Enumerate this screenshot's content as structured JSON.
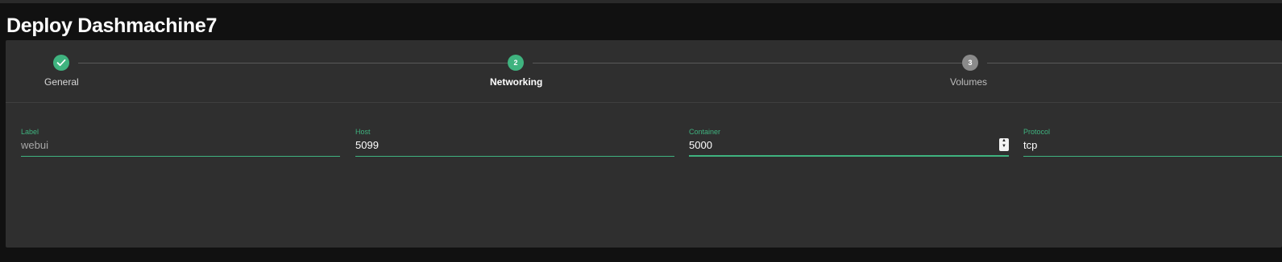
{
  "page": {
    "title": "Deploy Dashmachine7"
  },
  "stepper": {
    "steps": [
      {
        "number": "1",
        "label": "General",
        "state": "completed",
        "icon": "check-icon"
      },
      {
        "number": "2",
        "label": "Networking",
        "state": "active"
      },
      {
        "number": "3",
        "label": "Volumes",
        "state": "pending"
      }
    ]
  },
  "form": {
    "label": {
      "label": "Label",
      "value": "webui"
    },
    "host": {
      "label": "Host",
      "value": "5099"
    },
    "container": {
      "label": "Container",
      "value": "5000"
    },
    "protocol": {
      "label": "Protocol",
      "value": "tcp"
    }
  },
  "colors": {
    "accent": "#3fb37f",
    "background": "#111111",
    "card": "#2f2f2f",
    "pending_step": "#8a8a8a"
  }
}
